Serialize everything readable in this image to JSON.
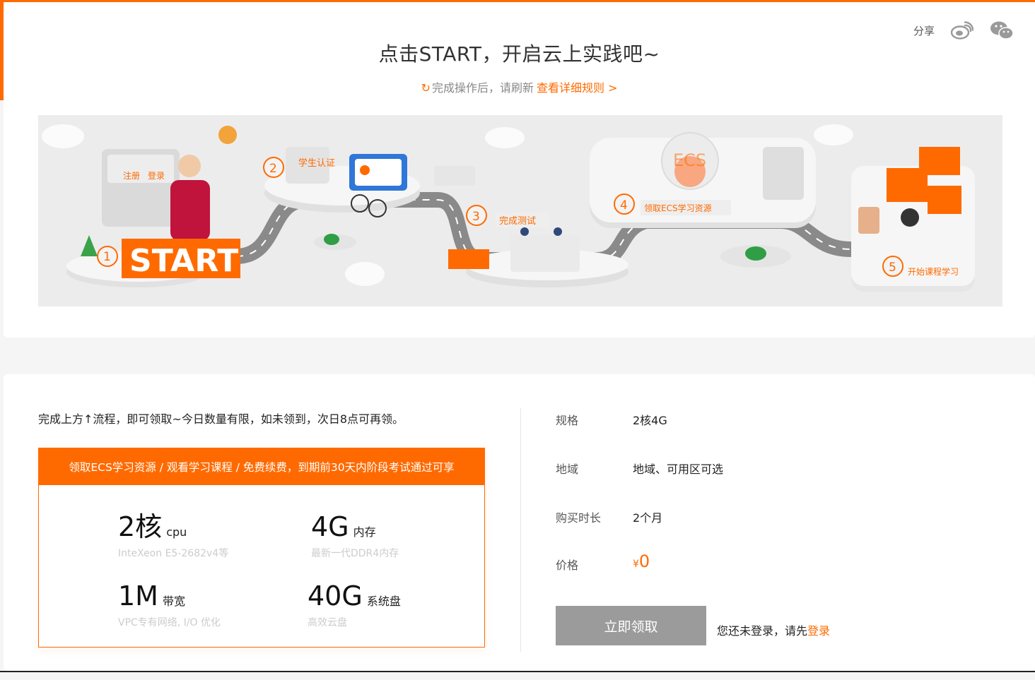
{
  "header": {
    "share_label": "分享",
    "title": "点击START，开启云上实践吧~",
    "subtitle_text": "完成操作后，请刷新",
    "rules_link": "查看详细规则 >"
  },
  "icons": {
    "refresh": "refresh-icon",
    "weibo": "weibo-icon",
    "wechat": "wechat-icon"
  },
  "banner": {
    "login_card": [
      "注册",
      "登录"
    ],
    "steps": [
      {
        "num": "1",
        "label": "START"
      },
      {
        "num": "2",
        "label": "学生认证"
      },
      {
        "num": "3",
        "label": "完成测试"
      },
      {
        "num": "4",
        "label": "领取ECS学习资源"
      },
      {
        "num": "5",
        "label": "开始课程学习"
      }
    ],
    "ecs_text": "ECS"
  },
  "offer": {
    "intro": "完成上方↑流程，即可领取~今日数量有限，如未领到，次日8点可再领。",
    "box_title": "领取ECS学习资源 / 观看学习课程 / 免费续费，到期前30天内阶段考试通过可享",
    "specs": [
      {
        "big": "2核",
        "unit": "cpu",
        "desc": "InteXeon E5-2682v4等"
      },
      {
        "big": "4G",
        "unit": "内存",
        "desc": "最新一代DDR4内存"
      },
      {
        "big": "1M",
        "unit": "带宽",
        "desc": "VPC专有网络, I/O 优化"
      },
      {
        "big": "40G",
        "unit": "系统盘",
        "desc": "高效云盘"
      }
    ]
  },
  "details": {
    "spec_label": "规格",
    "spec_value": "2核4G",
    "region_label": "地域",
    "region_value": "地域、可用区可选",
    "duration_label": "购买时长",
    "duration_value": "2个月",
    "price_label": "价格",
    "price_currency": "¥",
    "price_amount": "0"
  },
  "claim": {
    "button_label": "立即领取",
    "login_hint": "您还未登录，请先",
    "login_link": "登录"
  },
  "colors": {
    "accent": "#ff6a00",
    "button_disabled": "#9b9b9b"
  }
}
